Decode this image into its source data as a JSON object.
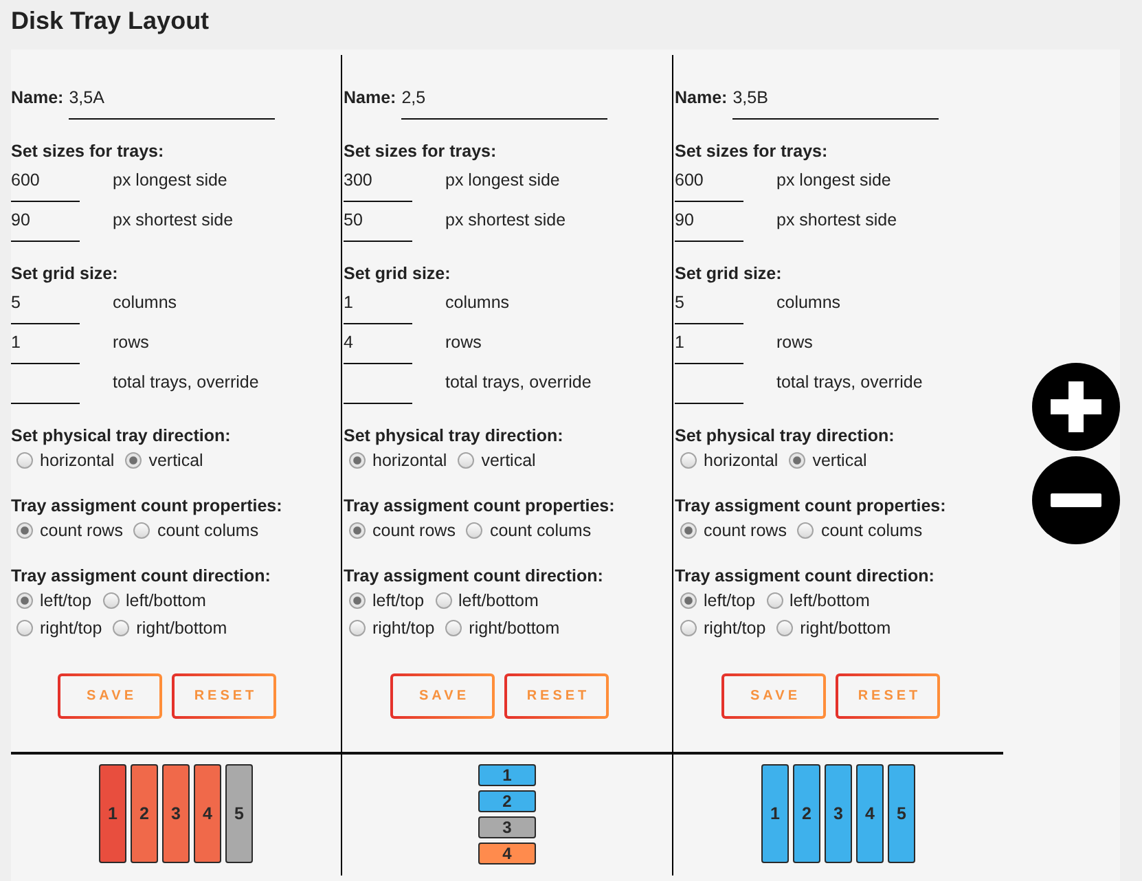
{
  "title": "Disk Tray Layout",
  "layouts": [
    {
      "name_label": "Name:",
      "name": "3,5A",
      "sizes_heading": "Set sizes for trays:",
      "size_fields": [
        {
          "value": "600",
          "label": "px longest side"
        },
        {
          "value": "90",
          "label": "px shortest side"
        }
      ],
      "grid_heading": "Set grid size:",
      "grid_fields": [
        {
          "value": "5",
          "label": "columns"
        },
        {
          "value": "1",
          "label": "rows"
        },
        {
          "label": "total trays, override"
        }
      ],
      "direction_heading": "Set physical tray direction:",
      "direction_options": [
        {
          "label": "horizontal",
          "selected": false
        },
        {
          "label": "vertical",
          "selected": true
        }
      ],
      "count_properties_heading": "Tray assigment count properties:",
      "count_properties_options": [
        {
          "label": "count rows",
          "selected": true
        },
        {
          "label": "count colums",
          "selected": false
        }
      ],
      "count_direction_heading": "Tray assigment count direction:",
      "count_direction_options": [
        {
          "label": "left/top",
          "selected": true
        },
        {
          "label": "left/bottom",
          "selected": false
        },
        {
          "label": "right/top",
          "selected": false
        },
        {
          "label": "right/bottom",
          "selected": false
        }
      ],
      "buttons": [
        "SAVE",
        "RESET"
      ],
      "trays": [
        {
          "label": "1",
          "color": "#e84e3e"
        },
        {
          "label": "2",
          "color": "#f0694a"
        },
        {
          "label": "3",
          "color": "#f0694a"
        },
        {
          "label": "4",
          "color": "#f0694a"
        },
        {
          "label": "5",
          "color": "#a9a9a9"
        }
      ]
    },
    {
      "name_label": "Name:",
      "name": "2,5",
      "sizes_heading": "Set sizes for trays:",
      "size_fields": [
        {
          "value": "300",
          "label": "px longest side"
        },
        {
          "value": "50",
          "label": "px shortest side"
        }
      ],
      "grid_heading": "Set grid size:",
      "grid_fields": [
        {
          "value": "1",
          "label": "columns"
        },
        {
          "value": "4",
          "label": "rows"
        },
        {
          "label": "total trays, override"
        }
      ],
      "direction_heading": "Set physical tray direction:",
      "direction_options": [
        {
          "label": "horizontal",
          "selected": true
        },
        {
          "label": "vertical",
          "selected": false
        }
      ],
      "count_properties_heading": "Tray assigment count properties:",
      "count_properties_options": [
        {
          "label": "count rows",
          "selected": true
        },
        {
          "label": "count colums",
          "selected": false
        }
      ],
      "count_direction_heading": "Tray assigment count direction:",
      "count_direction_options": [
        {
          "label": "left/top",
          "selected": true
        },
        {
          "label": "left/bottom",
          "selected": false
        },
        {
          "label": "right/top",
          "selected": false
        },
        {
          "label": "right/bottom",
          "selected": false
        }
      ],
      "buttons": [
        "SAVE",
        "RESET"
      ],
      "trays": [
        {
          "label": "1",
          "color": "#3eb1ec"
        },
        {
          "label": "2",
          "color": "#3eb1ec"
        },
        {
          "label": "3",
          "color": "#a9a9a9"
        },
        {
          "label": "4",
          "color": "#ff8b4d"
        }
      ]
    },
    {
      "name_label": "Name:",
      "name": "3,5B",
      "sizes_heading": "Set sizes for trays:",
      "size_fields": [
        {
          "value": "600",
          "label": "px longest side"
        },
        {
          "value": "90",
          "label": "px shortest side"
        }
      ],
      "grid_heading": "Set grid size:",
      "grid_fields": [
        {
          "value": "5",
          "label": "columns"
        },
        {
          "value": "1",
          "label": "rows"
        },
        {
          "label": "total trays, override"
        }
      ],
      "direction_heading": "Set physical tray direction:",
      "direction_options": [
        {
          "label": "horizontal",
          "selected": false
        },
        {
          "label": "vertical",
          "selected": true
        }
      ],
      "count_properties_heading": "Tray assigment count properties:",
      "count_properties_options": [
        {
          "label": "count rows",
          "selected": true
        },
        {
          "label": "count colums",
          "selected": false
        }
      ],
      "count_direction_heading": "Tray assigment count direction:",
      "count_direction_options": [
        {
          "label": "left/top",
          "selected": true
        },
        {
          "label": "left/bottom",
          "selected": false
        },
        {
          "label": "right/top",
          "selected": false
        },
        {
          "label": "right/bottom",
          "selected": false
        }
      ],
      "buttons": [
        "SAVE",
        "RESET"
      ],
      "trays": [
        {
          "label": "1",
          "color": "#3eb1ec"
        },
        {
          "label": "2",
          "color": "#3eb1ec"
        },
        {
          "label": "3",
          "color": "#3eb1ec"
        },
        {
          "label": "4",
          "color": "#3eb1ec"
        },
        {
          "label": "5",
          "color": "#3eb1ec"
        }
      ]
    }
  ]
}
